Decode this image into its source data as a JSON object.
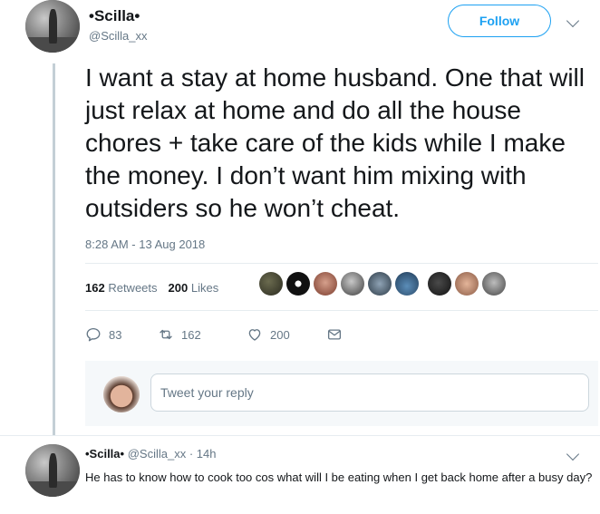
{
  "author": {
    "display_name": "•Scilla•",
    "handle": "@Scilla_xx"
  },
  "follow_button": {
    "label": "Follow"
  },
  "tweet": {
    "text": "I want a stay at home husband. One that will just relax at home and do all the house chores + take care of the kids while I make the money. I don’t want him mixing with outsiders so he won’t cheat.",
    "timestamp": "8:28 AM - 13 Aug 2018"
  },
  "stats": {
    "retweets_count": "162",
    "retweets_label": "Retweets",
    "likes_count": "200",
    "likes_label": "Likes"
  },
  "actions": {
    "replies": "83",
    "retweets": "162",
    "likes": "200"
  },
  "reply_box": {
    "placeholder": "Tweet your reply"
  },
  "reply": {
    "display_name": "•Scilla•",
    "handle": "@Scilla_xx",
    "time": "· 14h",
    "text": "He has to know how to cook too cos what will I be eating when I get back home after a busy day?"
  },
  "colors": {
    "accent": "#1da1f2",
    "secondary_text": "#657786",
    "thread_line": "#c4cfd6"
  },
  "icons": [
    "reply-icon",
    "retweet-icon",
    "heart-icon",
    "message-icon",
    "chevron-down-icon"
  ]
}
